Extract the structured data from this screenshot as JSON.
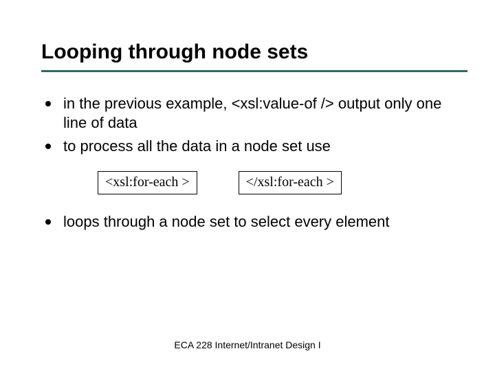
{
  "title": "Looping through node sets",
  "bullets": {
    "b1": "in the previous example, <xsl:value-of /> output only one line of data",
    "b2": "to process all the data in a node set use",
    "b3": "loops through a node set to select every element"
  },
  "code": {
    "open": "<xsl:for-each >",
    "close": "</xsl:for-each >"
  },
  "footer": "ECA 228  Internet/Intranet Design I"
}
